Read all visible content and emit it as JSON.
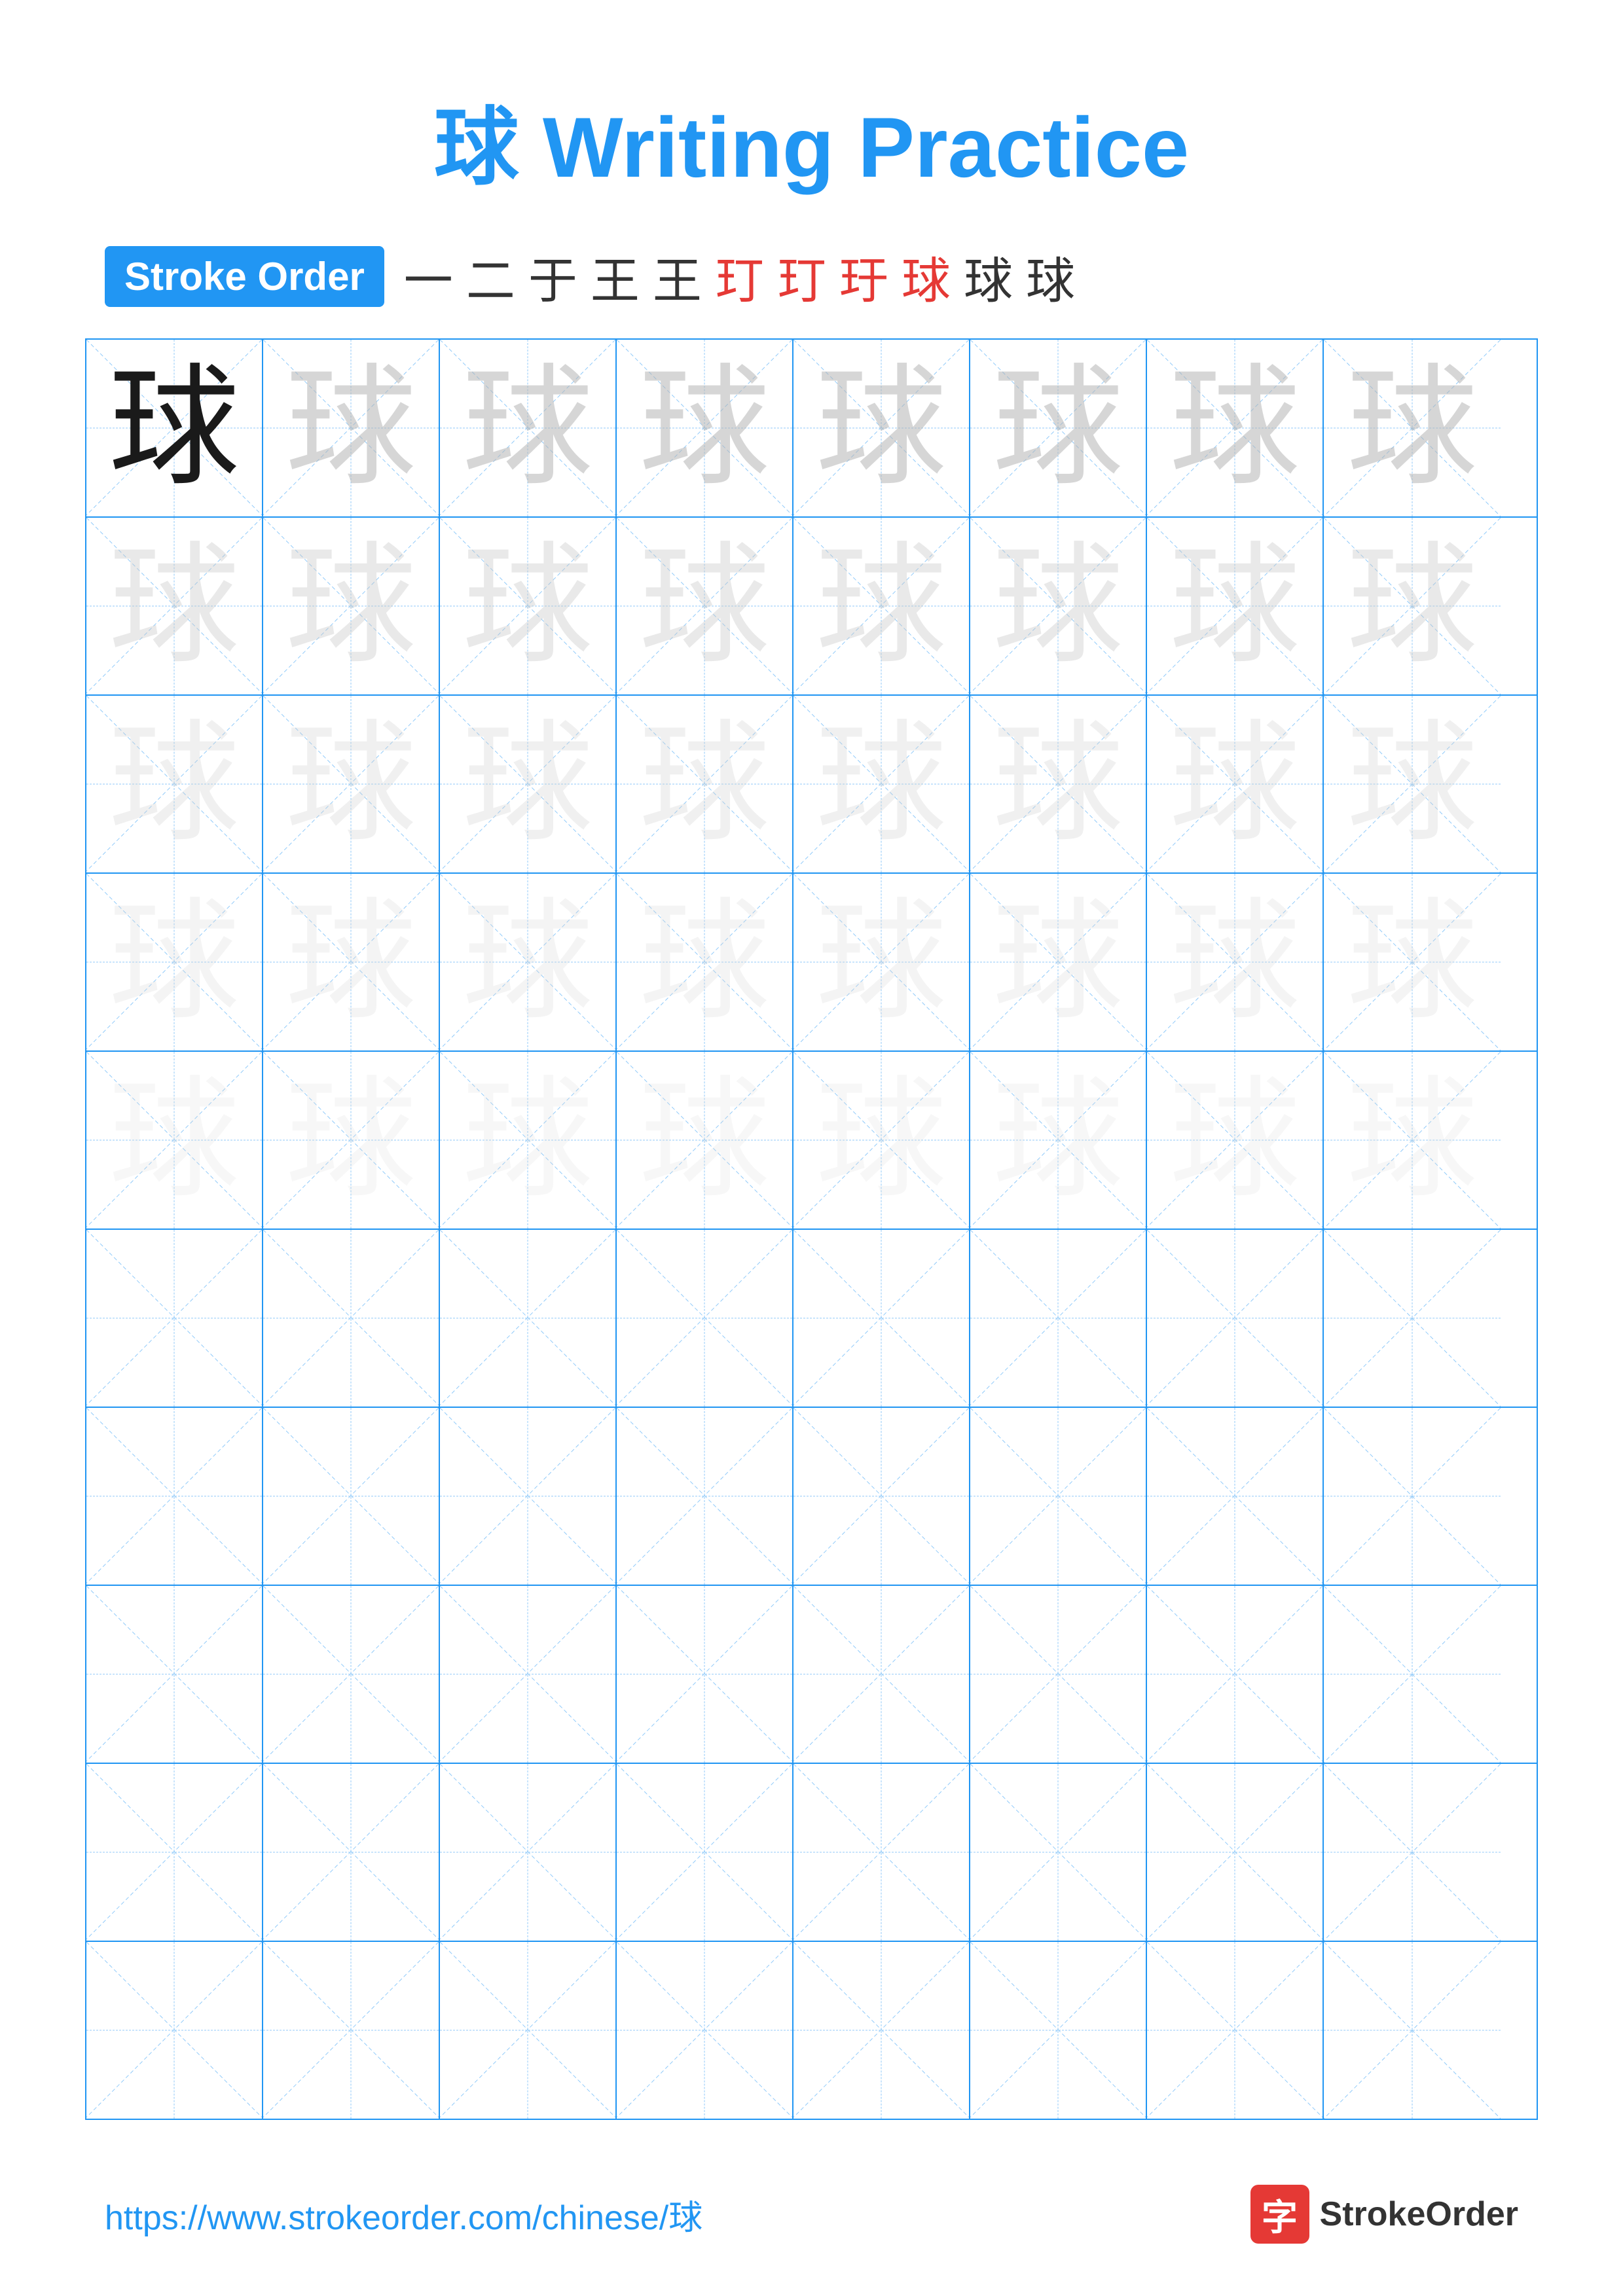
{
  "title": "球 Writing Practice",
  "stroke_order": {
    "badge_label": "Stroke Order",
    "chars": [
      "一",
      "二",
      "于",
      "王",
      "王",
      "玎",
      "玎",
      "玗",
      "球",
      "球",
      "球"
    ]
  },
  "character": "球",
  "grid": {
    "cols": 8,
    "rows": 10,
    "practice_rows": 5,
    "empty_rows": 5
  },
  "footer": {
    "url": "https://www.strokeorder.com/chinese/球",
    "logo_char": "字",
    "logo_text": "StrokeOrder"
  }
}
